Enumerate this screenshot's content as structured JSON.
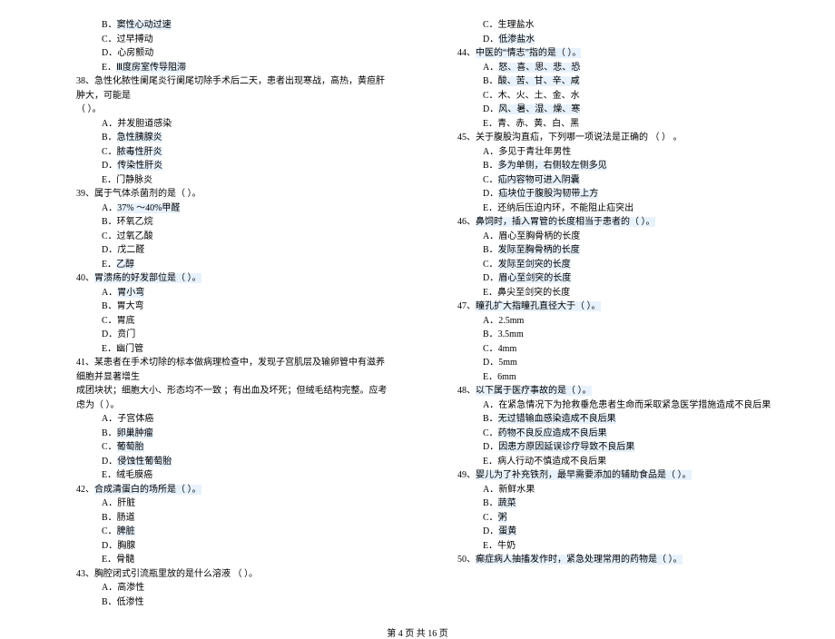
{
  "left": {
    "pre_options": [
      {
        "k": "B",
        "t": "窦性心动过速",
        "hl": true
      },
      {
        "k": "C",
        "t": "过早搏动",
        "hl": false
      },
      {
        "k": "D",
        "t": "心房颤动",
        "hl": false
      },
      {
        "k": "E",
        "t": "Ⅲ度房室传导阻滞",
        "hl": true
      }
    ],
    "q38": {
      "num": "38、",
      "text": "急性化脓性阑尾炎行阑尾切除手术后二天，患者出现寒战，高热，黄疸肝肿大，可能是",
      "paren": "（        ）。",
      "opts": [
        {
          "k": "A",
          "t": "并发胆道感染",
          "hl": false
        },
        {
          "k": "B",
          "t": "急性胰腺炎",
          "hl": true
        },
        {
          "k": "C",
          "t": "脓毒性肝炎",
          "hl": true
        },
        {
          "k": "D",
          "t": "传染性肝炎",
          "hl": true
        },
        {
          "k": "E",
          "t": "门静脉炎",
          "hl": false
        }
      ]
    },
    "q39": {
      "num": "39、",
      "text": "属于气体杀菌剂的是（        ）。",
      "opts": [
        {
          "k": "A",
          "t": "37% ～40%甲醛",
          "hl": true
        },
        {
          "k": "B",
          "t": "环氧乙烷",
          "hl": false
        },
        {
          "k": "C",
          "t": "过氧乙酸",
          "hl": false
        },
        {
          "k": "D",
          "t": "戊二醛",
          "hl": false
        },
        {
          "k": "E",
          "t": "乙醇",
          "hl": true
        }
      ]
    },
    "q40": {
      "num": "40、",
      "text": "胃溃疡的好发部位是（        ）。",
      "hl": true,
      "opts": [
        {
          "k": "A",
          "t": "胃小弯",
          "hl": true
        },
        {
          "k": "B",
          "t": "胃大弯",
          "hl": false
        },
        {
          "k": "C",
          "t": "胃底",
          "hl": false
        },
        {
          "k": "D",
          "t": "贲门",
          "hl": false
        },
        {
          "k": "E",
          "t": "幽门管",
          "hl": false
        }
      ]
    },
    "q41": {
      "num": "41、",
      "text1": "某患者在手术切除的标本做病理检查中，发现子宫肌层及输卵管中有滋养细胞并显著增生",
      "text2": "成团块状；细胞大小、形态均不一致      ；有出血及坏死；但绒毛结构完整。应考虑为（        ）。",
      "opts": [
        {
          "k": "A",
          "t": "子宫体癌",
          "hl": false
        },
        {
          "k": "B",
          "t": "卵巢肿瘤",
          "hl": true
        },
        {
          "k": "C",
          "t": "葡萄胎",
          "hl": true
        },
        {
          "k": "D",
          "t": "侵蚀性葡萄胎",
          "hl": true
        },
        {
          "k": "E",
          "t": "绒毛膜癌",
          "hl": false
        }
      ]
    },
    "q42": {
      "num": "42、",
      "text": "合成清蛋白的场所是（        ）。",
      "hl": true,
      "opts": [
        {
          "k": "A",
          "t": "肝脏",
          "hl": false
        },
        {
          "k": "B",
          "t": "肠道",
          "hl": false
        },
        {
          "k": "C",
          "t": "脾脏",
          "hl": true
        },
        {
          "k": "D",
          "t": "胸腺",
          "hl": false
        },
        {
          "k": "E",
          "t": "骨髓",
          "hl": false
        }
      ]
    },
    "q43": {
      "num": "43、",
      "text": "胸腔闭式引流瓶里放的是什么溶液     （        ）。",
      "opts": [
        {
          "k": "A",
          "t": "高渗性",
          "hl": false
        },
        {
          "k": "B",
          "t": "低渗性",
          "hl": false
        }
      ]
    }
  },
  "right": {
    "pre_options": [
      {
        "k": "C",
        "t": "生理盐水",
        "hl": false
      },
      {
        "k": "D",
        "t": "低渗盐水",
        "hl": true
      }
    ],
    "q44": {
      "num": "44、",
      "text": "中医的“情志”指的是（        ）。",
      "hl": true,
      "opts": [
        {
          "k": "A",
          "t": "怒、喜、思、悲、恐",
          "hl": true
        },
        {
          "k": "B",
          "t": "酸、苦、甘、辛、咸",
          "hl": true
        },
        {
          "k": "C",
          "t": "木、火、土、金、水",
          "hl": false
        },
        {
          "k": "D",
          "t": "风、暑、湿、燥、寒",
          "hl": true
        },
        {
          "k": "E",
          "t": "青、赤、黄、白、黑",
          "hl": false
        }
      ]
    },
    "q45": {
      "num": "45、",
      "text": "关于腹股沟直疝，下列哪一项说法是正确的      （        ）    。",
      "opts": [
        {
          "k": "A",
          "t": "多见于青壮年男性",
          "hl": false
        },
        {
          "k": "B",
          "t": "多为单侧，右侧较左侧多见",
          "hl": true
        },
        {
          "k": "C",
          "t": "疝内容物可进入阴囊",
          "hl": true
        },
        {
          "k": "D",
          "t": "疝块位于腹股沟韧带上方",
          "hl": true
        },
        {
          "k": "E",
          "t": "还纳后压迫内环，不能阻止疝突出",
          "hl": false
        }
      ]
    },
    "q46": {
      "num": "46、",
      "text": "鼻饲时，插入胃管的长度相当于患者的（        ）。",
      "hl": true,
      "opts": [
        {
          "k": "A",
          "t": "眉心至胸骨柄的长度",
          "hl": false
        },
        {
          "k": "B",
          "t": "发际至胸骨柄的长度",
          "hl": true
        },
        {
          "k": "C",
          "t": "发际至剑突的长度",
          "hl": true
        },
        {
          "k": "D",
          "t": "眉心至剑突的长度",
          "hl": true
        },
        {
          "k": "E",
          "t": "鼻尖至剑突的长度",
          "hl": false
        }
      ]
    },
    "q47": {
      "num": "47、",
      "text": "瞳孔扩大指瞳孔直径大于（        ）。",
      "hl": true,
      "opts": [
        {
          "k": "A",
          "t": "2.5mm",
          "hl": false
        },
        {
          "k": "B",
          "t": "3.5mm",
          "hl": false
        },
        {
          "k": "C",
          "t": "4mm",
          "hl": false
        },
        {
          "k": "D",
          "t": "5mm",
          "hl": false
        },
        {
          "k": "E",
          "t": "6mm",
          "hl": false
        }
      ]
    },
    "q48": {
      "num": "48、",
      "text": "以下属于医疗事故的是（        ）。",
      "hl": true,
      "opts": [
        {
          "k": "A",
          "t": "在紧急情况下为抢救垂危患者生命而采取紧急医学措施造成不良后果",
          "hl": false
        },
        {
          "k": "B",
          "t": "无过错输血感染造成不良后果",
          "hl": true
        },
        {
          "k": "C",
          "t": "药物不良反应造成不良后果",
          "hl": true
        },
        {
          "k": "D",
          "t": "因患方原因延误诊疗导致不良后果",
          "hl": true
        },
        {
          "k": "E",
          "t": "病人行动不慎造成不良后果",
          "hl": false
        }
      ]
    },
    "q49": {
      "num": "49、",
      "text": "婴儿为了补充铁剂，最早需要添加的辅助食品是（        ）。",
      "hl": true,
      "opts": [
        {
          "k": "A",
          "t": "新鲜水果",
          "hl": false
        },
        {
          "k": "B",
          "t": "蔬菜",
          "hl": true
        },
        {
          "k": "C",
          "t": "粥",
          "hl": true
        },
        {
          "k": "D",
          "t": "蛋黄",
          "hl": true
        },
        {
          "k": "E",
          "t": "牛奶",
          "hl": false
        }
      ]
    },
    "q50": {
      "num": "50、",
      "text": "癫症病人抽搐发作时，紧急处理常用的药物是（        ）。",
      "hl": true
    }
  },
  "pager": "第 4 页 共 16 页"
}
